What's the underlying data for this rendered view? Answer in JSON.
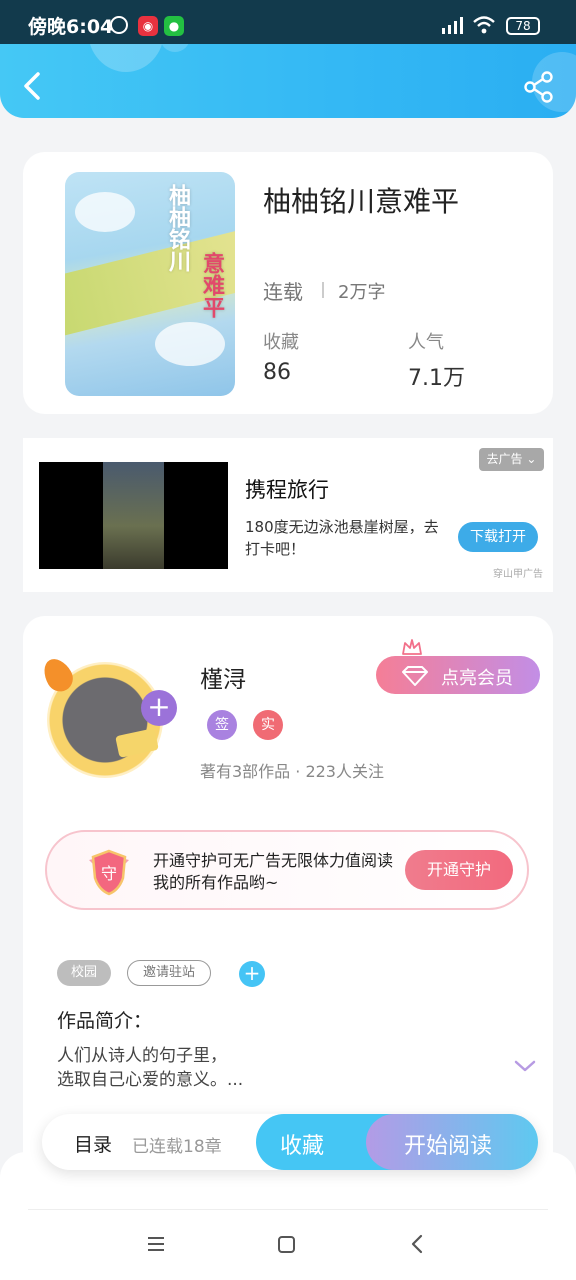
{
  "status_bar": {
    "time": "傍晚6:04",
    "battery": "78",
    "app_icons": [
      "alarm-icon",
      "netease-music-icon",
      "wechat-icon"
    ]
  },
  "header": {
    "back_icon": "chevron-left-icon",
    "share_icon": "share-icon"
  },
  "book": {
    "title": "柚柚铭川意难平",
    "status": "连载",
    "word_count": "2万字",
    "stats": [
      {
        "label": "收藏",
        "value": "86"
      },
      {
        "label": "人气",
        "value": "7.1万"
      }
    ],
    "cover_text": [
      "柚柚铭川",
      "意难平"
    ]
  },
  "ad": {
    "dismiss_label": "去广告",
    "title": "携程旅行",
    "description": "180度无边泳池悬崖树屋，去打卡吧！",
    "download_label": "下载打开",
    "source": "穿山甲广告"
  },
  "author": {
    "name": "槿浔",
    "badges": [
      "签",
      "实"
    ],
    "meta": "著有3部作品 · 223人关注",
    "vip_label": "点亮会员"
  },
  "guard": {
    "text": "开通守护可无广告无限体力值阅读我的所有作品哟~",
    "button_label": "开通守护",
    "shield_char": "守"
  },
  "tags": {
    "items": [
      "校园"
    ],
    "invite_label": "邀请驻站"
  },
  "intro": {
    "heading": "作品简介：",
    "text": "人们从诗人的句子里，\n选取自己心爱的意义。..."
  },
  "action_bar": {
    "toc_label": "目录",
    "chapter_count": "已连载18章",
    "collect_label": "收藏",
    "read_label": "开始阅读"
  },
  "colors": {
    "header_gradient_start": "#45c8f5",
    "header_gradient_end": "#2aaef2",
    "accent_blue": "#45c6f4",
    "accent_purple": "#9b72d9",
    "accent_pink": "#f26a7e"
  }
}
